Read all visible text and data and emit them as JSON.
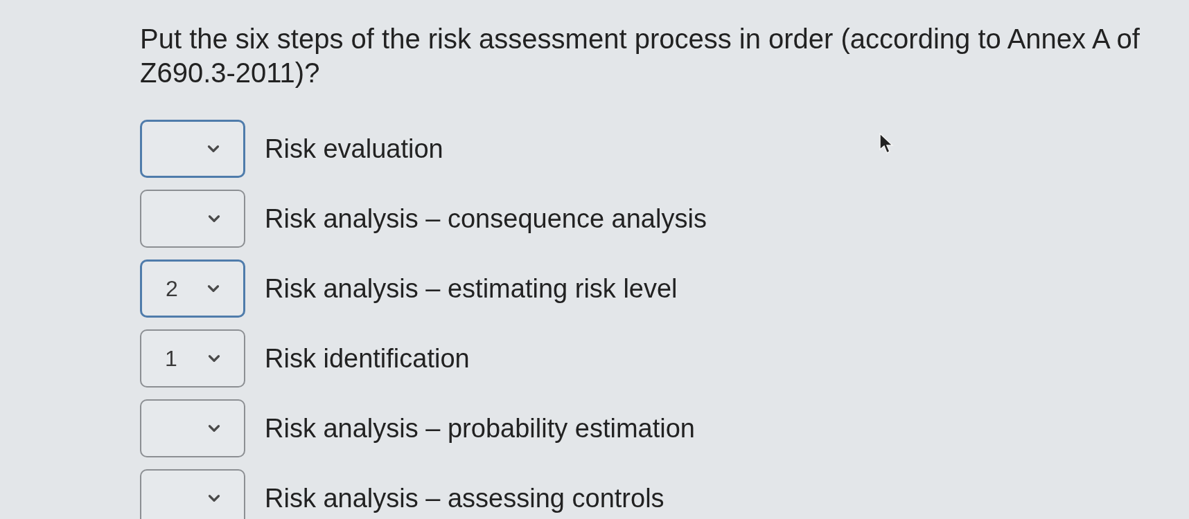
{
  "question": {
    "text": "Put the six steps of the risk assessment process in order (according to Annex A of Z690.3-2011)?"
  },
  "items": [
    {
      "label": "Risk evaluation",
      "highlighted": true
    },
    {
      "label": "Risk analysis – consequence analysis",
      "highlighted": false
    },
    {
      "value": "2",
      "label": "Risk analysis – estimating risk level",
      "highlighted": true
    },
    {
      "value": "1",
      "label": "Risk identification",
      "highlighted": false
    },
    {
      "label": "Risk analysis – probability estimation",
      "highlighted": false
    },
    {
      "label": "Risk analysis – assessing controls",
      "highlighted": false
    }
  ]
}
